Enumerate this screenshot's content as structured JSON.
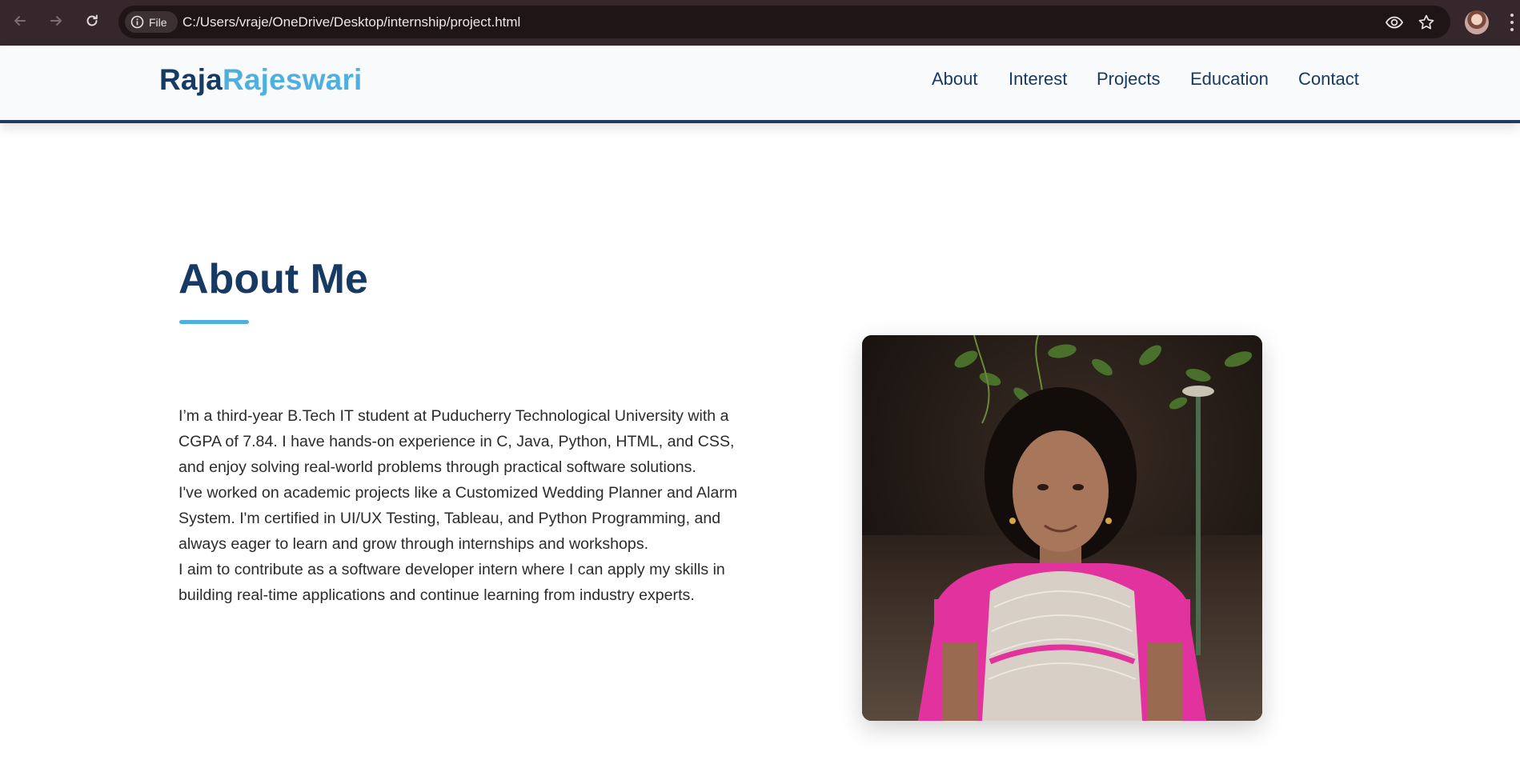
{
  "browser": {
    "site_chip_label": "File",
    "url": "C:/Users/vraje/OneDrive/Desktop/internship/project.html",
    "icons": {
      "back": "arrow-left-icon",
      "forward": "arrow-right-icon",
      "reload": "reload-icon",
      "info": "info-icon",
      "reading_mode": "eye-icon",
      "bookmark": "star-icon",
      "profile": "avatar",
      "menu": "kebab-menu-icon"
    }
  },
  "header": {
    "logo_first": "Raja",
    "logo_last": "Rajeswari",
    "nav": [
      "About",
      "Interest",
      "Projects",
      "Education",
      "Contact"
    ]
  },
  "about": {
    "title": "About Me",
    "paragraphs": [
      "I’m a third-year B.Tech IT student at Puducherry Technological University with a CGPA of 7.84. I have hands-on experience in C, Java, Python, HTML, and CSS, and enjoy solving real-world problems through practical software solutions.",
      "I've worked on academic projects like a Customized Wedding Planner and Alarm System. I'm certified in UI/UX Testing, Tableau, and Python Programming, and always eager to learn and grow through internships and workshops.",
      "I aim to contribute as a software developer intern where I can apply my skills in building real-time applications and continue learning from industry experts."
    ]
  },
  "colors": {
    "brand_dark": "#163a63",
    "brand_light": "#4fb0df",
    "chrome_bg": "#35272b"
  }
}
